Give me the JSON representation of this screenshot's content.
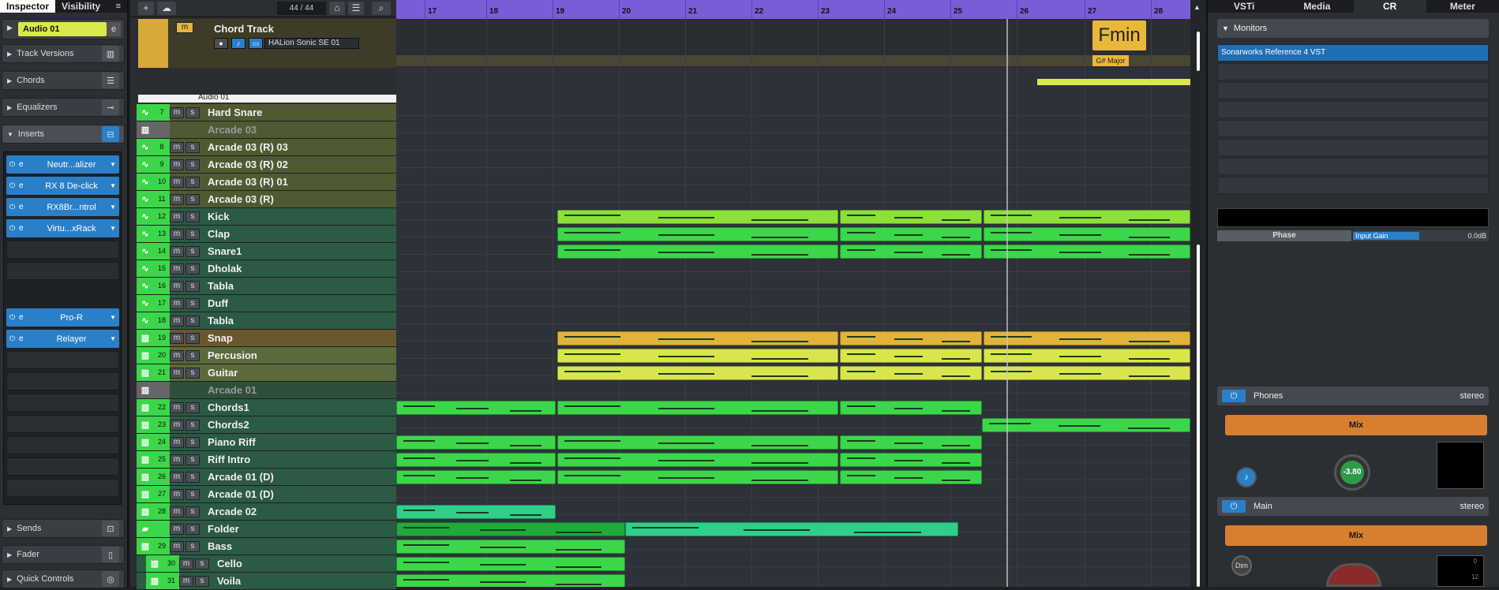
{
  "inspector": {
    "tabs": [
      "Inspector",
      "Visibility"
    ],
    "menu": "≡",
    "track_name": "Audio 01",
    "sections": {
      "track_versions": "Track Versions",
      "chords": "Chords",
      "equalizers": "Equalizers",
      "inserts": "Inserts",
      "sends": "Sends",
      "fader": "Fader",
      "quick_controls": "Quick Controls"
    },
    "inserts": [
      "Neutr...alizer",
      "RX 8 De-click",
      "RX8Br...ntrol",
      "Virtu...xRack",
      "Pro-R",
      "Relayer"
    ]
  },
  "toolbar": {
    "add": "+",
    "track_count": "44 / 44"
  },
  "ruler": {
    "bars": [
      "17",
      "18",
      "19",
      "20",
      "21",
      "22",
      "23",
      "24",
      "25",
      "26",
      "27",
      "28"
    ]
  },
  "chord_track": {
    "name": "Chord Track",
    "instrument": "HALion Sonic SE 01",
    "chord": "Fmin",
    "scale": "G# Major"
  },
  "audio_track_name": "Audio 01",
  "tracks": [
    {
      "num": "7",
      "name": "Hard Snare",
      "type": "audio"
    },
    {
      "num": "",
      "name": "Arcade 03",
      "type": "folder-label"
    },
    {
      "num": "8",
      "name": "Arcade 03 (R) 03",
      "type": "audio"
    },
    {
      "num": "9",
      "name": "Arcade 03 (R) 02",
      "type": "audio"
    },
    {
      "num": "10",
      "name": "Arcade 03 (R) 01",
      "type": "audio"
    },
    {
      "num": "11",
      "name": "Arcade 03 (R)",
      "type": "audio"
    },
    {
      "num": "12",
      "name": "Kick",
      "type": "audio"
    },
    {
      "num": "13",
      "name": "Clap",
      "type": "audio"
    },
    {
      "num": "14",
      "name": "Snare1",
      "type": "audio"
    },
    {
      "num": "15",
      "name": "Dholak",
      "type": "audio"
    },
    {
      "num": "16",
      "name": "Tabla",
      "type": "audio"
    },
    {
      "num": "17",
      "name": "Duff",
      "type": "audio"
    },
    {
      "num": "18",
      "name": "Tabla",
      "type": "audio"
    },
    {
      "num": "19",
      "name": "Snap",
      "type": "midi"
    },
    {
      "num": "20",
      "name": "Percusion",
      "type": "midi"
    },
    {
      "num": "21",
      "name": "Guitar",
      "type": "midi"
    },
    {
      "num": "",
      "name": "Arcade 01",
      "type": "folder-label"
    },
    {
      "num": "22",
      "name": "Chords1",
      "type": "midi"
    },
    {
      "num": "23",
      "name": "Chords2",
      "type": "midi"
    },
    {
      "num": "24",
      "name": "Piano Riff",
      "type": "midi"
    },
    {
      "num": "25",
      "name": "Riff Intro",
      "type": "midi"
    },
    {
      "num": "26",
      "name": "Arcade 01 (D)",
      "type": "midi"
    },
    {
      "num": "27",
      "name": "Arcade 01 (D)",
      "type": "midi"
    },
    {
      "num": "28",
      "name": "Arcade 02",
      "type": "midi"
    },
    {
      "num": "",
      "name": "Folder",
      "type": "folder"
    },
    {
      "num": "29",
      "name": "Bass",
      "type": "midi"
    },
    {
      "num": "30",
      "name": "Cello",
      "type": "midi"
    },
    {
      "num": "31",
      "name": "Voila",
      "type": "midi"
    }
  ],
  "right_panel": {
    "tabs": [
      "VSTi",
      "Media",
      "CR",
      "Meter"
    ],
    "monitors": "Monitors",
    "monitor_plugin": "Sonarworks Reference 4 VST",
    "phase": "Phase",
    "input_gain": "Input Gain",
    "input_gain_value": "0.0dB",
    "phones": "Phones",
    "phones_mode": "stereo",
    "mix": "Mix",
    "phones_knob": "-3.80",
    "main": "Main",
    "main_mode": "stereo",
    "dim": "Dim",
    "meter_zero": "0",
    "meter_twelve": "12"
  },
  "colors": {
    "ruler": "#7a5cd9",
    "audio_green": "#3cd64a",
    "kick": "#8ce03a",
    "snap": "#e0b43a",
    "percusion": "#d8e64b",
    "mix": "#d87f2f"
  }
}
